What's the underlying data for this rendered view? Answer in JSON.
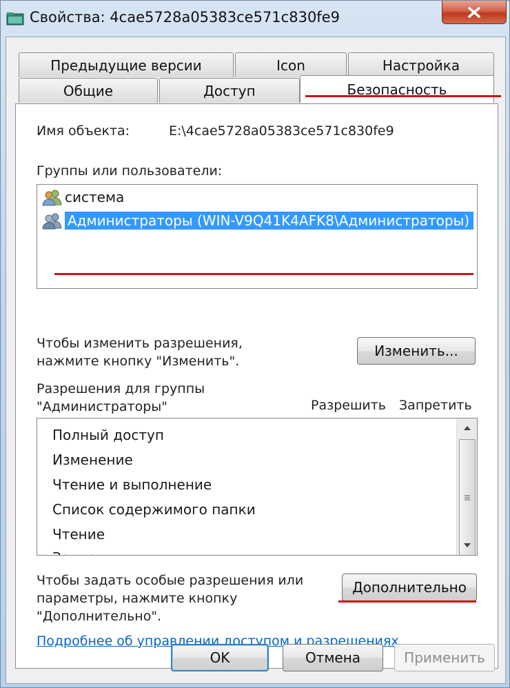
{
  "window": {
    "title": "Свойства: 4cae5728a05383ce571c830fe9",
    "close_icon": "close-icon"
  },
  "tabs": {
    "row1": [
      "Предыдущие версии",
      "Icon",
      "Настройка"
    ],
    "row2": [
      "Общие",
      "Доступ",
      "Безопасность"
    ],
    "active": "Безопасность"
  },
  "security": {
    "object_name_label": "Имя объекта:",
    "object_name_value": "E:\\4cae5728a05383ce571c830fe9",
    "groups_label": "Группы или пользователи:",
    "groups": [
      {
        "name": "система",
        "icon": "users-icon",
        "selected": false
      },
      {
        "name": "Администраторы (WIN-V9Q41K4AFK8\\Администраторы)",
        "icon": "users-icon",
        "selected": true
      }
    ],
    "change_hint_line1": "Чтобы изменить разрешения,",
    "change_hint_line2": "нажмите кнопку \"Изменить\".",
    "change_button": "Изменить...",
    "perms_label_line1": "Разрешения для группы",
    "perms_label_line2": "\"Администраторы\"",
    "allow_header": "Разрешить",
    "deny_header": "Запретить",
    "permissions": [
      "Полный доступ",
      "Изменение",
      "Чтение и выполнение",
      "Список содержимого папки",
      "Чтение",
      "Запись"
    ],
    "advanced_hint_line1": "Чтобы задать особые разрешения или",
    "advanced_hint_line2": "параметры, нажмите кнопку",
    "advanced_hint_line3": "\"Дополнительно\".",
    "advanced_button": "Дополнительно",
    "help_link": "Подробнее об управлении доступом и разрешениях"
  },
  "footer": {
    "ok": "OK",
    "cancel": "Отмена",
    "apply": "Применить"
  },
  "colors": {
    "highlight": "#d0101a",
    "selection": "#3399ff",
    "link": "#0066cc"
  }
}
